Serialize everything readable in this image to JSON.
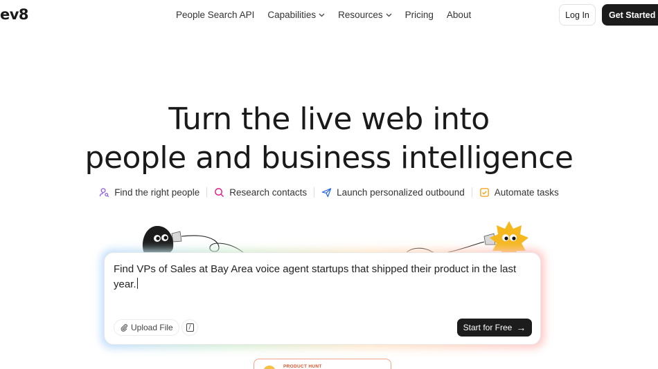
{
  "brand": {
    "logo_text": "ev8"
  },
  "nav": {
    "links": [
      {
        "label": "People Search API",
        "dropdown": false
      },
      {
        "label": "Capabilities",
        "dropdown": true
      },
      {
        "label": "Resources",
        "dropdown": true
      },
      {
        "label": "Pricing",
        "dropdown": false
      },
      {
        "label": "About",
        "dropdown": false
      }
    ],
    "login_label": "Log In",
    "get_started_label": "Get Started"
  },
  "hero": {
    "headline_line1": "Turn the live web into",
    "headline_line2": "people and business intelligence",
    "features": [
      {
        "label": "Find the right people",
        "icon": "person-search-icon",
        "color": "#8b5cf6"
      },
      {
        "label": "Research contacts",
        "icon": "magnifier-icon",
        "color": "#e11d8a"
      },
      {
        "label": "Launch personalized outbound",
        "icon": "send-icon",
        "color": "#2563eb"
      },
      {
        "label": "Automate tasks",
        "icon": "checkbox-icon",
        "color": "#f59e0b"
      }
    ]
  },
  "prompt_box": {
    "value": "Find VPs of Sales at Bay Area voice agent startups that shipped their product in the last year.",
    "upload_label": "Upload File",
    "slash_label": "/",
    "submit_label": "Start for Free",
    "submit_arrow": "→"
  },
  "product_hunt": {
    "label": "PRODUCT HUNT"
  }
}
